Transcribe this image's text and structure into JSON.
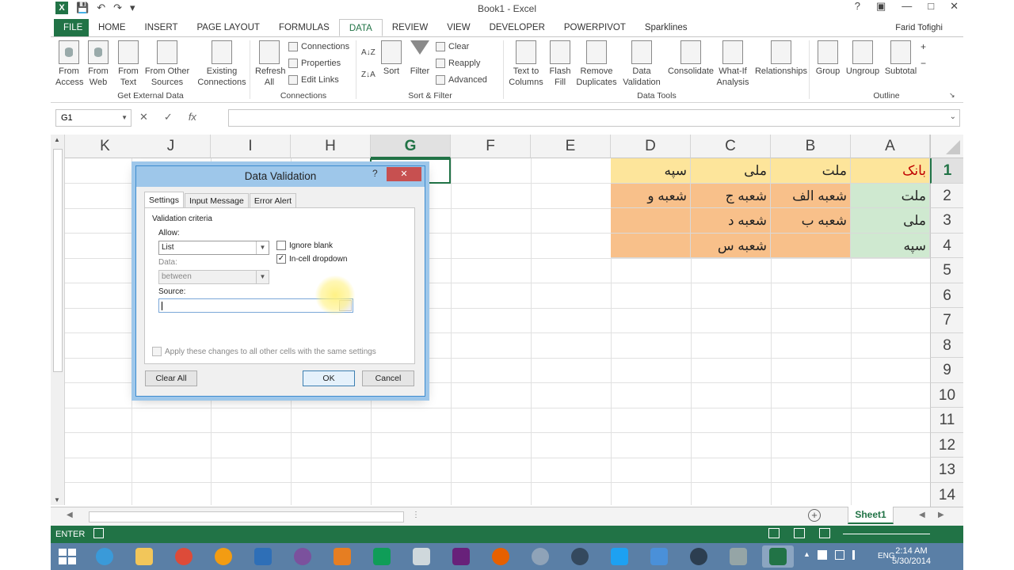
{
  "window": {
    "title": "Book1 - Excel",
    "user": "Farid Tofighi"
  },
  "ribbon": {
    "tabs": [
      "FILE",
      "HOME",
      "INSERT",
      "PAGE LAYOUT",
      "FORMULAS",
      "DATA",
      "REVIEW",
      "VIEW",
      "DEVELOPER",
      "POWERPIVOT",
      "Sparklines"
    ],
    "active_tab": "DATA",
    "groups": {
      "get_external": {
        "label": "Get External Data",
        "from_access": "From\nAccess",
        "from_web": "From\nWeb",
        "from_text": "From\nText",
        "from_other": "From Other\nSources",
        "existing": "Existing\nConnections"
      },
      "connections": {
        "label": "Connections",
        "refresh": "Refresh\nAll",
        "connections": "Connections",
        "properties": "Properties",
        "edit_links": "Edit Links"
      },
      "sort_filter": {
        "label": "Sort & Filter",
        "sort": "Sort",
        "filter": "Filter",
        "clear": "Clear",
        "reapply": "Reapply",
        "advanced": "Advanced"
      },
      "data_tools": {
        "label": "Data Tools",
        "text_to_columns": "Text to\nColumns",
        "flash_fill": "Flash\nFill",
        "remove_duplicates": "Remove\nDuplicates",
        "data_validation": "Data\nValidation",
        "consolidate": "Consolidate",
        "what_if": "What-If\nAnalysis",
        "relationships": "Relationships"
      },
      "outline": {
        "label": "Outline",
        "group": "Group",
        "ungroup": "Ungroup",
        "subtotal": "Subtotal"
      }
    }
  },
  "formula_bar": {
    "name_box": "G1",
    "cancel": "✕",
    "enter": "✓",
    "fx": "fx",
    "value": ""
  },
  "grid": {
    "columns": [
      "K",
      "J",
      "I",
      "H",
      "G",
      "F",
      "E",
      "D",
      "C",
      "B",
      "A"
    ],
    "selected_column": "G",
    "rows": [
      "1",
      "2",
      "3",
      "4",
      "5",
      "6",
      "7",
      "8",
      "9",
      "10",
      "11",
      "12",
      "13",
      "14"
    ],
    "selected_row": "1",
    "cells": {
      "A1": "بانک",
      "B1": "ملت",
      "C1": "ملی",
      "D1": "سپه",
      "A2": "ملت",
      "B2": "شعبه الف",
      "C2": "شعبه ج",
      "D2": "شعبه و",
      "A3": "ملی",
      "B3": "شعبه ب",
      "C3": "شعبه د",
      "D3": "",
      "A4": "سپه",
      "B4": "",
      "C4": "شعبه س",
      "D4": ""
    }
  },
  "sheet_tabs": {
    "active": "Sheet1"
  },
  "status": {
    "mode": "ENTER"
  },
  "dialog": {
    "title": "Data Validation",
    "help": "?",
    "close": "✕",
    "tabs": [
      "Settings",
      "Input Message",
      "Error Alert"
    ],
    "active_tab": "Settings",
    "criteria_label": "Validation criteria",
    "allow_label": "Allow:",
    "allow_value": "List",
    "data_label": "Data:",
    "data_value": "between",
    "ignore_blank": "Ignore blank",
    "ignore_blank_checked": false,
    "in_cell_dropdown": "In-cell dropdown",
    "in_cell_dropdown_checked": true,
    "source_label": "Source:",
    "source_value": "",
    "apply_all": "Apply these changes to all other cells with the same settings",
    "clear_all": "Clear All",
    "ok": "OK",
    "cancel": "Cancel"
  },
  "taskbar": {
    "language": "ENG",
    "time": "2:14 AM",
    "date": "5/30/2014"
  },
  "colors": {
    "excel_green": "#217346",
    "header_yellow": "#fde59b",
    "bank_green": "#cfe9d0",
    "branch_orange": "#f8c08a",
    "bank_title_red": "#c00000"
  }
}
